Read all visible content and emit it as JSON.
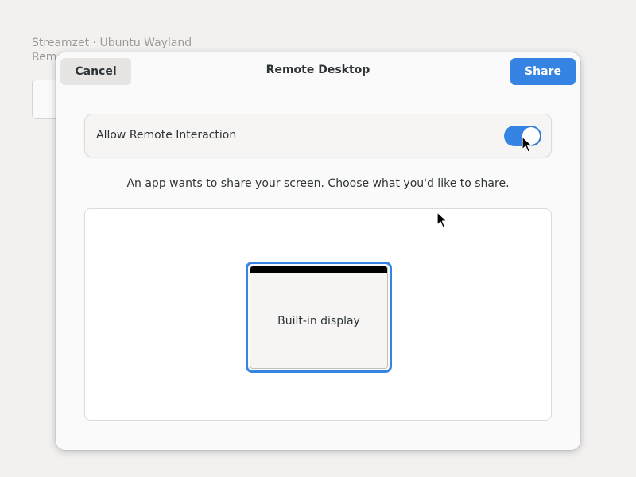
{
  "background": {
    "app_line1": "Streamzet · Ubuntu Wayland",
    "app_line2": "Rem"
  },
  "dialog": {
    "title": "Remote Desktop",
    "cancel_label": "Cancel",
    "share_label": "Share",
    "remote_interaction": {
      "label": "Allow Remote Interaction",
      "enabled": true
    },
    "description": "An app wants to share your screen. Choose what you'd like to share.",
    "monitors": [
      {
        "label": "Built-in display",
        "selected": true
      }
    ]
  },
  "colors": {
    "accent": "#3584e4",
    "dialog_bg": "#fafafa",
    "page_bg": "#f2f1f0"
  },
  "icons": {
    "pointer": "mouse-pointer-icon"
  }
}
